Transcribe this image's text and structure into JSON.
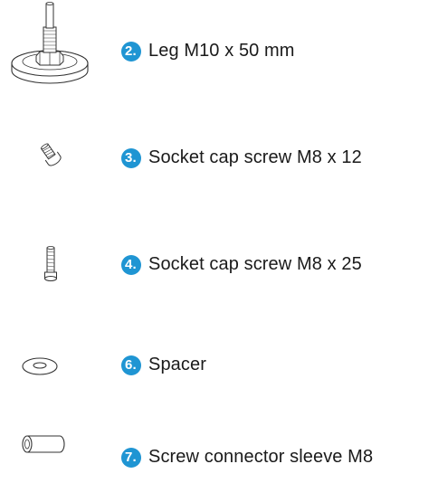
{
  "parts": [
    {
      "number": "2.",
      "name": "Leg M10 x 50 mm",
      "icon": "leg-icon"
    },
    {
      "number": "3.",
      "name": "Socket cap screw M8 x 12",
      "icon": "short-screw-icon"
    },
    {
      "number": "4.",
      "name": "Socket cap screw M8 x 25",
      "icon": "long-screw-icon"
    },
    {
      "number": "6.",
      "name": "Spacer",
      "icon": "spacer-icon"
    },
    {
      "number": "7.",
      "name": "Screw connector sleeve M8",
      "icon": "sleeve-icon"
    }
  ],
  "colors": {
    "badge": "#1f95d3",
    "line": "#333333",
    "text": "#1a1a1a"
  }
}
